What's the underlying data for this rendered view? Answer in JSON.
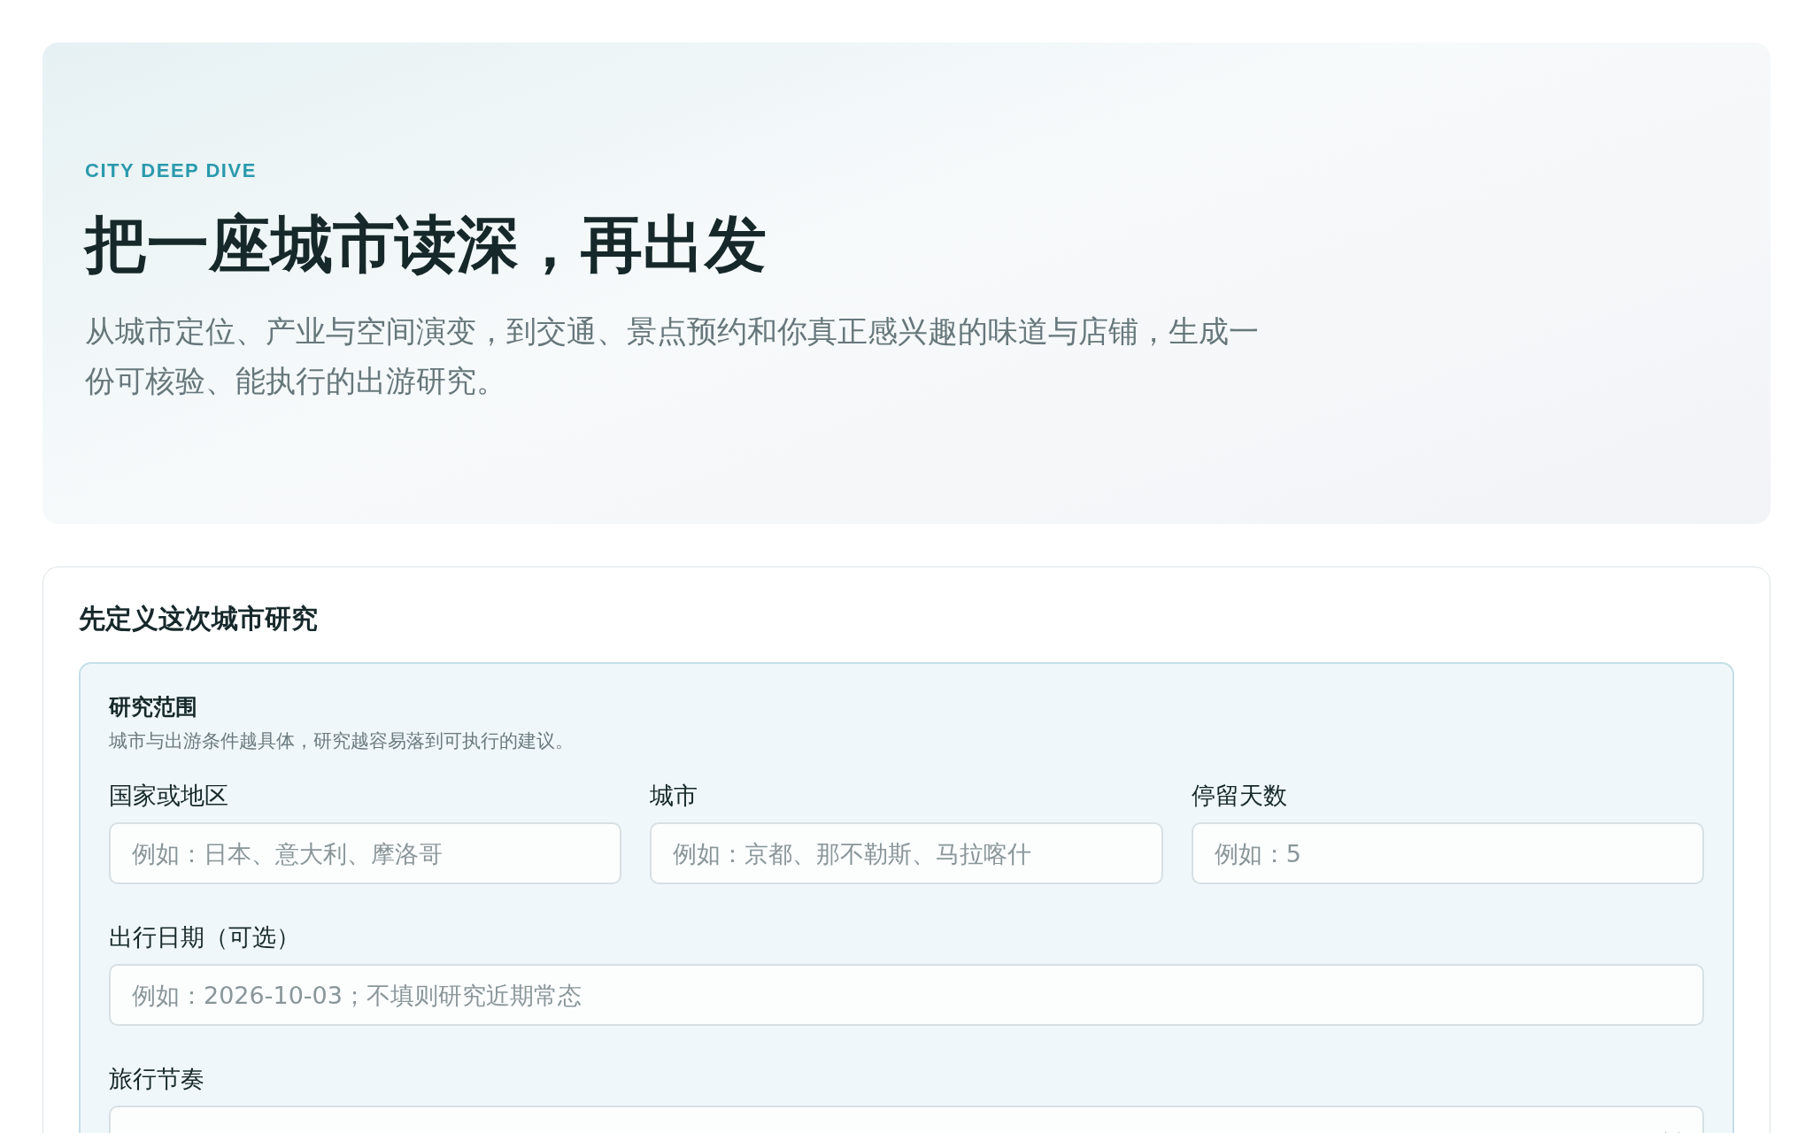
{
  "hero": {
    "eyebrow": "CITY DEEP DIVE",
    "title": "把一座城市读深，再出发",
    "description": "从城市定位、产业与空间演变，到交通、景点预约和你真正感兴趣的味道与店铺，生成一份可核验、能执行的出游研究。"
  },
  "form": {
    "title": "先定义这次城市研究",
    "section": {
      "title": "研究范围",
      "description": "城市与出游条件越具体，研究越容易落到可执行的建议。",
      "rows": [
        [
          {
            "kind": "text",
            "label": "国家或地区",
            "placeholder": "例如：日本、意大利、摩洛哥"
          },
          {
            "kind": "text",
            "label": "城市",
            "placeholder": "例如：京都、那不勒斯、马拉喀什"
          },
          {
            "kind": "text",
            "label": "停留天数",
            "placeholder": "例如：5"
          }
        ],
        [
          {
            "kind": "text",
            "label": "出行日期（可选）",
            "placeholder": "例如：2026-10-03；不填则研究近期常态"
          }
        ],
        [
          {
            "kind": "select",
            "label": "旅行节奏"
          }
        ]
      ]
    }
  }
}
